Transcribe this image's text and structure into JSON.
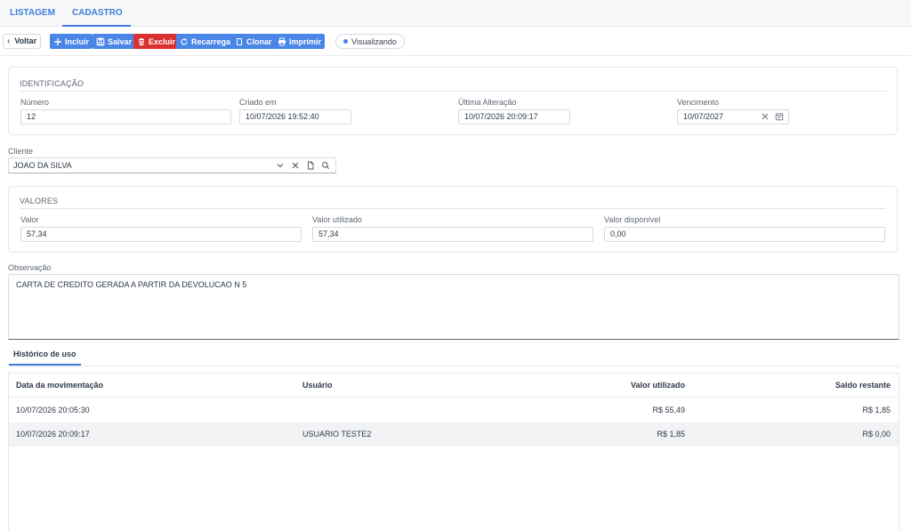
{
  "tabs": [
    {
      "label": "LISTAGEM"
    },
    {
      "label": "CADASTRO"
    }
  ],
  "toolbar": {
    "back_label": "Voltar",
    "buttons": [
      {
        "label": "Incluir",
        "icon": "plus-icon"
      },
      {
        "label": "Salvar",
        "icon": "save-icon"
      },
      {
        "label": "Excluir",
        "icon": "trash-icon"
      },
      {
        "label": "Recarrega",
        "icon": "refresh-icon"
      },
      {
        "label": "Clonar",
        "icon": "copy-icon"
      },
      {
        "label": "Imprimir",
        "icon": "printer-icon"
      }
    ],
    "status": "Visualizando"
  },
  "identificacao": {
    "title": "IDENTIFICAÇÃO",
    "numero": {
      "label": "Número",
      "value": "12"
    },
    "criado_em": {
      "label": "Criado em",
      "value": "10/07/2026 19:52:40"
    },
    "ultima_alteracao": {
      "label": "Última Alteração",
      "value": "10/07/2026 20:09:17"
    },
    "vencimento": {
      "label": "Vencimento",
      "value": "10/07/2027"
    }
  },
  "cliente": {
    "label": "Cliente",
    "value": "JOAO DA SILVA"
  },
  "valores": {
    "title": "VALORES",
    "valor": {
      "label": "Valor",
      "value": "57,34"
    },
    "valor_utilizado": {
      "label": "Valor utilizado",
      "value": "57,34"
    },
    "valor_disponivel": {
      "label": "Valor disponível",
      "value": "0,00"
    }
  },
  "observacao": {
    "label": "Observação",
    "value": "CARTA DE CREDITO GERADA A PARTIR DA DEVOLUCAO N 5"
  },
  "historico": {
    "tab_label": "Histórico de uso",
    "columns": [
      "Data da movimentação",
      "Usuário",
      "Valor utilizado",
      "Saldo restante"
    ],
    "rows": [
      {
        "data": "10/07/2026 20:05:30",
        "usuario": "",
        "valor": "R$ 55,49",
        "saldo": "R$ 1,85"
      },
      {
        "data": "10/07/2026 20:09:17",
        "usuario": "USUARIO TESTE2",
        "valor": "R$ 1,85",
        "saldo": "R$ 0,00"
      }
    ]
  },
  "colors": {
    "accent": "#4a86e8",
    "danger": "#d93030"
  }
}
